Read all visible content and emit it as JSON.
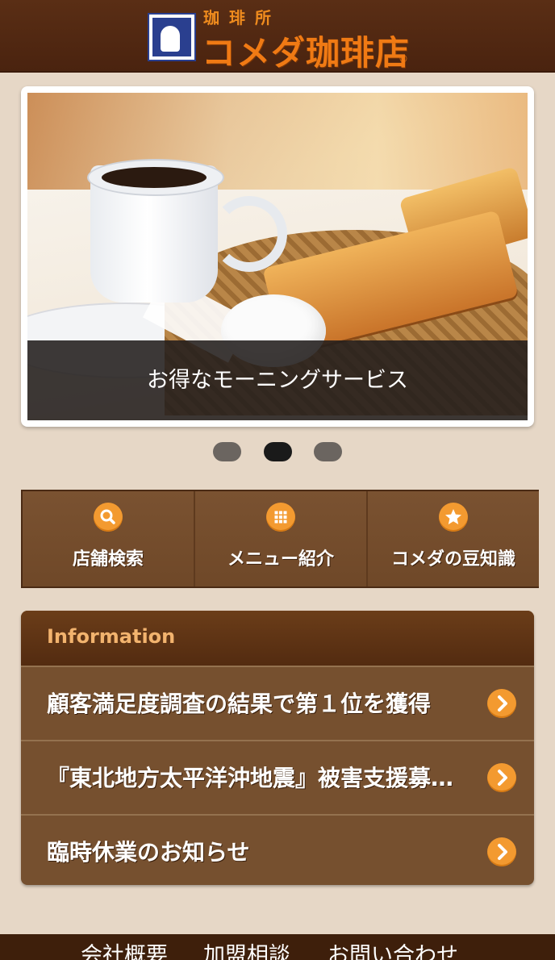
{
  "header": {
    "logo_sub": "珈琲所",
    "logo_main": "コメダ珈琲店",
    "logo_reg": "®"
  },
  "slider": {
    "caption": "お得なモーニングサービス",
    "active_dot": 2,
    "dot_count": 3
  },
  "nav": {
    "items": [
      {
        "label": "店舗検索",
        "icon": "search-icon"
      },
      {
        "label": "メニュー紹介",
        "icon": "grid-icon"
      },
      {
        "label": "コメダの豆知識",
        "icon": "star-icon"
      }
    ]
  },
  "info": {
    "title": "Information",
    "items": [
      "顧客満足度調査の結果で第１位を獲得",
      "『東北地方太平洋沖地震』被害支援募…",
      "臨時休業のお知らせ"
    ]
  },
  "footer": {
    "links": [
      "会社概要",
      "加盟相談",
      "お問い合わせ"
    ]
  },
  "colors": {
    "header_bg": "#4a230f",
    "accent_orange": "#f39a30",
    "panel_brown": "#76502f",
    "page_bg": "#e6d7c6"
  }
}
